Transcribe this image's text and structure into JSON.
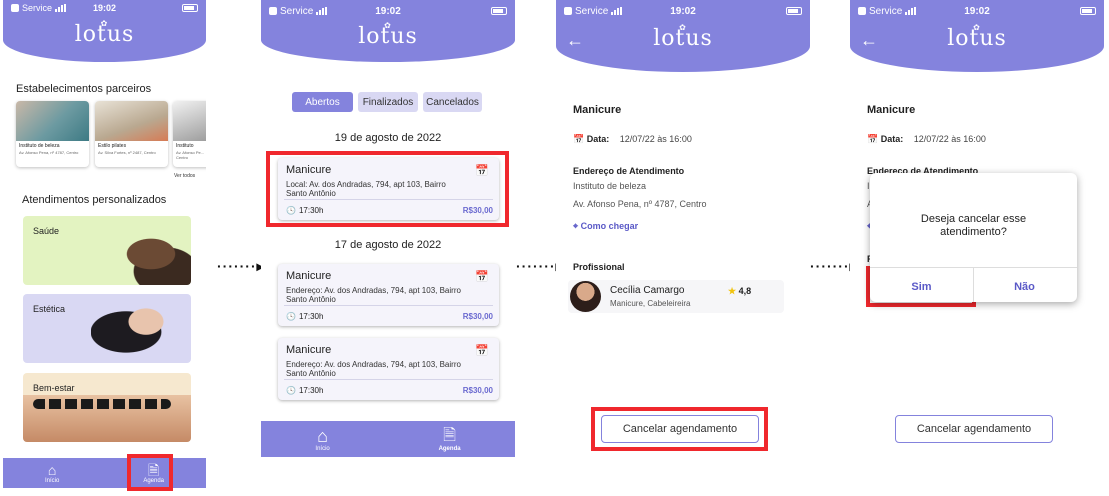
{
  "status": {
    "carrier": "Service",
    "time": "19:02"
  },
  "app": {
    "logo": "lotus"
  },
  "screen1": {
    "partners_title": "Estabelecimentos parceiros",
    "partners": [
      {
        "name": "Instituto de beleza",
        "address": "Av. Afonso Pena, nº 4787, Centro"
      },
      {
        "name": "Estilo pilates",
        "address": "Av. Silva Fortes, nº 2487, Centro"
      },
      {
        "name": "Instituto",
        "address": "Av. Afonso Pe... Centro"
      }
    ],
    "see_all": "Ver todos",
    "personalized_title": "Atendimentos personalizados",
    "categories": [
      {
        "label": "Saúde",
        "color": "#e3f3c1"
      },
      {
        "label": "Estética",
        "color": "#d9d8f3"
      },
      {
        "label": "Bem-estar",
        "color": "#f6e8cf"
      }
    ],
    "tabs": [
      {
        "label": "Início",
        "icon": "home-icon"
      },
      {
        "label": "Agenda",
        "icon": "agenda-icon"
      }
    ]
  },
  "screen2": {
    "filters": [
      {
        "label": "Abertos",
        "active": true
      },
      {
        "label": "Finalizados",
        "active": false
      },
      {
        "label": "Cancelados",
        "active": false
      }
    ],
    "groups": [
      {
        "date": "19 de agosto de 2022",
        "items": [
          {
            "service": "Manicure",
            "address": "Local: Av. dos Andradas, 794, apt 103, Bairro Santo Antônio",
            "time": "17:30h",
            "price": "R$30,00"
          }
        ]
      },
      {
        "date": "17 de agosto de 2022",
        "items": [
          {
            "service": "Manicure",
            "address": "Endereço: Av. dos Andradas, 794, apt 103, Bairro Santo Antônio",
            "time": "17:30h",
            "price": "R$30,00"
          },
          {
            "service": "Manicure",
            "address": "Endereço: Av. dos Andradas, 794, apt 103, Bairro Santo Antônio",
            "time": "17:30h",
            "price": "R$30,00"
          }
        ]
      }
    ],
    "tabs": [
      {
        "label": "Início",
        "icon": "home-icon"
      },
      {
        "label": "Agenda",
        "icon": "agenda-icon"
      }
    ]
  },
  "detail": {
    "service": "Manicure",
    "date_label": "Data:",
    "date_value": "12/07/22 às 16:00",
    "address_title": "Endereço de Atendimento",
    "place": "Instituto de beleza",
    "address": "Av. Afonso Pena, nº 4787, Centro",
    "directions": "Como chegar",
    "professional_title": "Profissional",
    "professional_name": "Cecília Camargo",
    "professional_role": "Manicure, Cabeleireira",
    "rating": "4,8",
    "cancel_button": "Cancelar agendamento"
  },
  "dialog": {
    "question_line1": "Deseja cancelar esse",
    "question_line2": "atendimento?",
    "yes": "Sim",
    "no": "Não"
  },
  "colors": {
    "primary": "#8483dd",
    "highlight": "#f0282d",
    "accent": "#5a59c7"
  }
}
